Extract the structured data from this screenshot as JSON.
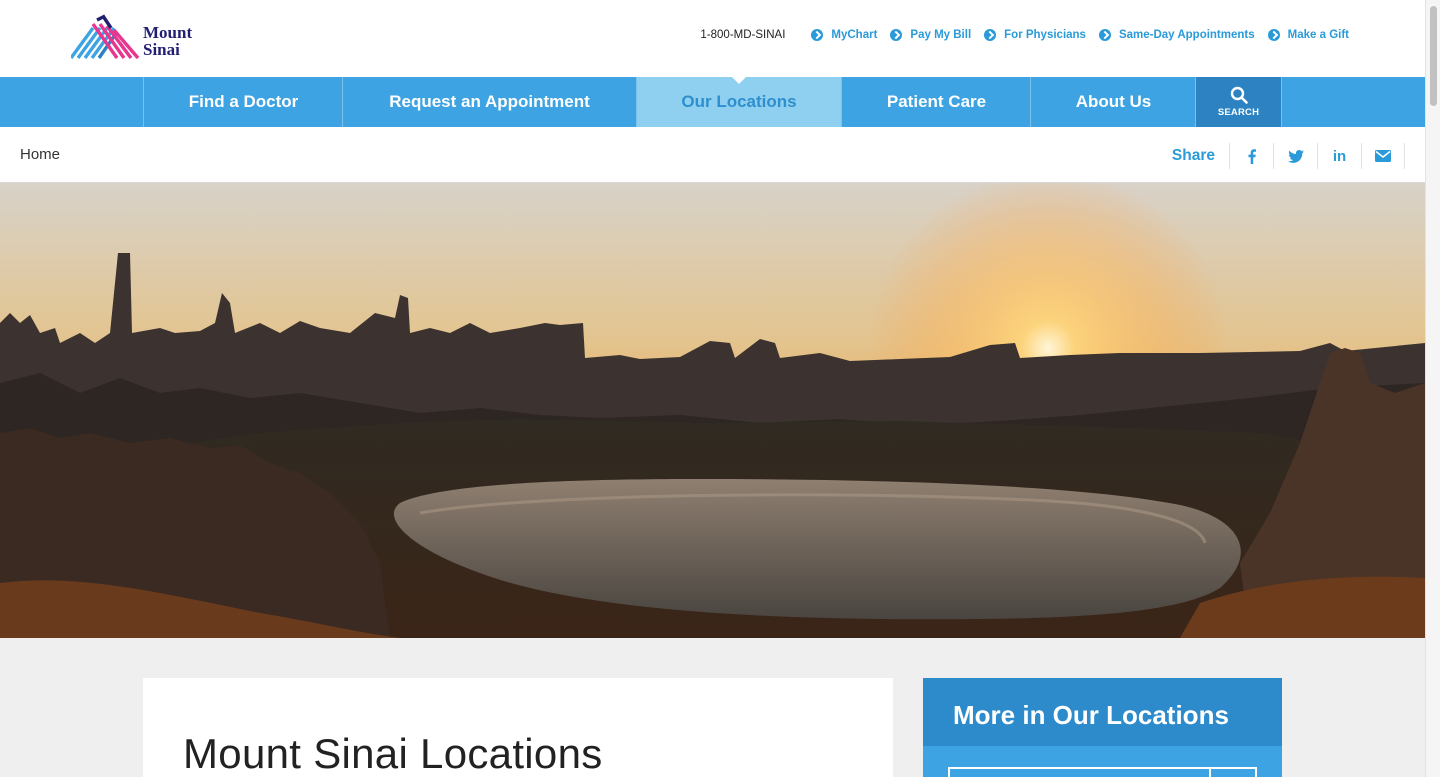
{
  "brand": {
    "name_line1": "Mount",
    "name_line2": "Sinai"
  },
  "utility": {
    "phone": "1-800-MD-SINAI",
    "links": [
      {
        "label": "MyChart"
      },
      {
        "label": "Pay My Bill"
      },
      {
        "label": "For Physicians"
      },
      {
        "label": "Same-Day Appointments"
      },
      {
        "label": "Make a Gift"
      }
    ]
  },
  "nav": {
    "items": [
      {
        "label": "Find a Doctor"
      },
      {
        "label": "Request an Appointment"
      },
      {
        "label": "Our Locations"
      },
      {
        "label": "Patient Care"
      },
      {
        "label": "About Us"
      }
    ],
    "active": "Our Locations",
    "search_label": "SEARCH"
  },
  "breadcrumb": {
    "home": "Home"
  },
  "share": {
    "label": "Share",
    "icons": [
      "facebook-icon",
      "twitter-icon",
      "linkedin-icon",
      "email-icon"
    ],
    "linkedin_text": "in"
  },
  "main": {
    "title": "Mount Sinai Locations"
  },
  "sidebar": {
    "title": "More in Our Locations"
  },
  "colors": {
    "accent": "#3da3e2",
    "dark_accent": "#2d83c2",
    "link": "#2a9ad8",
    "brand_navy": "#221f72"
  }
}
